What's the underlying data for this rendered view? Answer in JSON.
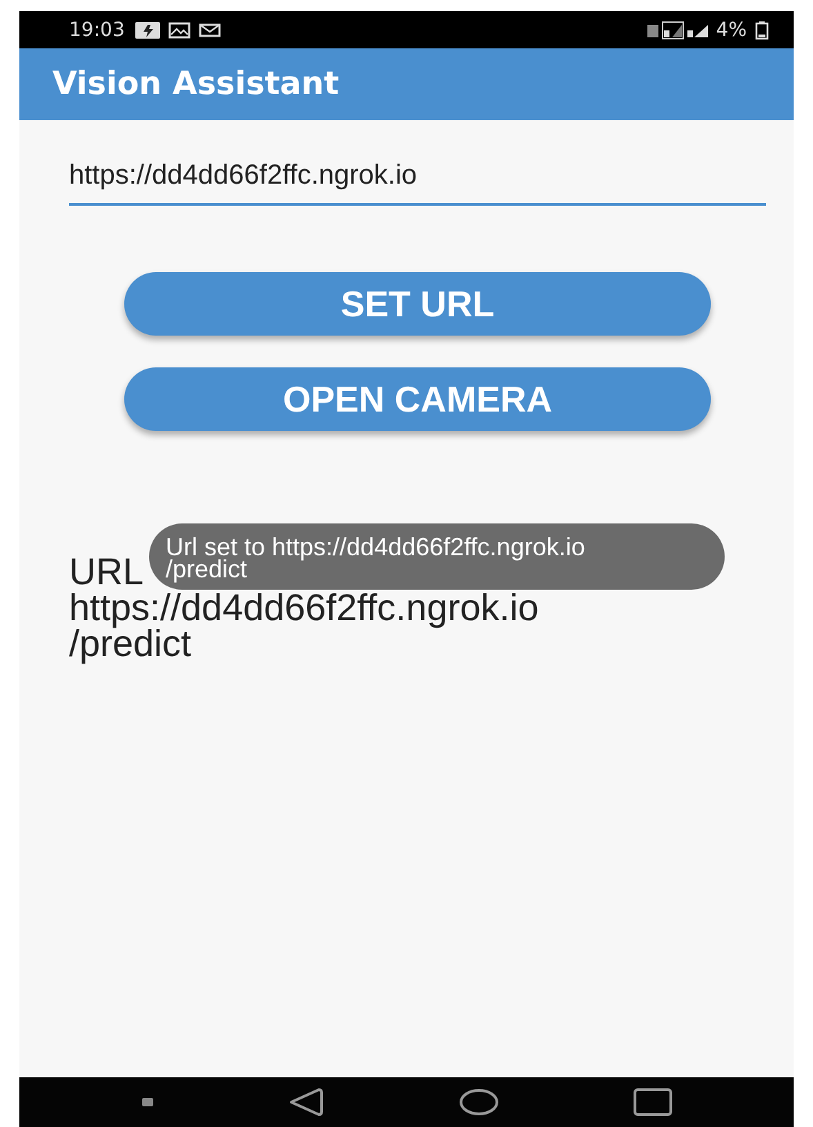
{
  "status_bar": {
    "time": "19:03",
    "battery": "4%"
  },
  "app_bar": {
    "title": "Vision Assistant"
  },
  "url_field": {
    "value": "https://dd4dd66f2ffc.ngrok.io"
  },
  "buttons": [
    {
      "label": "SET URL"
    },
    {
      "label": "OPEN CAMERA"
    }
  ],
  "current_url": {
    "lines": [
      "URL",
      "https://dd4dd66f2ffc.ngrok.io",
      "/predict"
    ]
  },
  "toast": {
    "lines": [
      "Url set to https://dd4dd66f2ffc.ngrok.io",
      "/predict"
    ]
  }
}
